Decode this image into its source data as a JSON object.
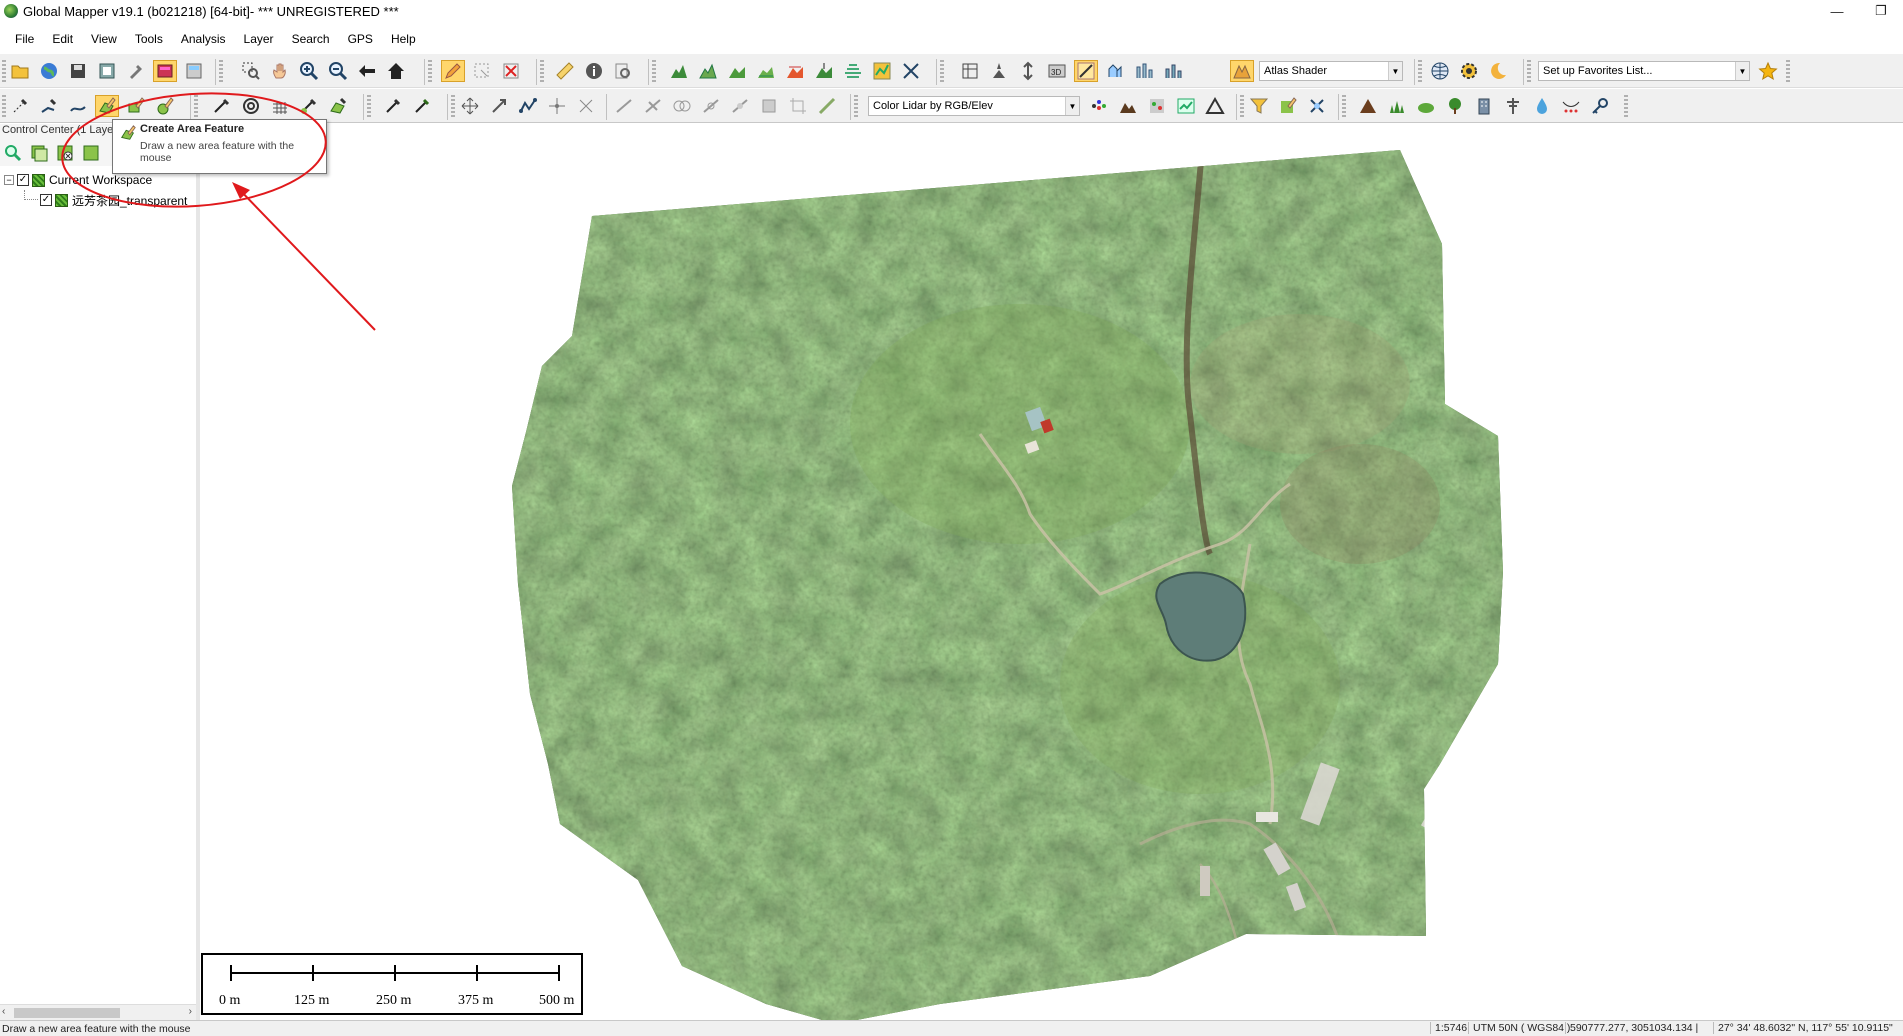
{
  "window": {
    "title": "Global Mapper v19.1 (b021218) [64-bit]- *** UNREGISTERED ***",
    "minimize": "—",
    "restore": "❐",
    "close": "✕"
  },
  "menu": [
    "File",
    "Edit",
    "View",
    "Tools",
    "Analysis",
    "Layer",
    "Search",
    "GPS",
    "Help"
  ],
  "toolbar": {
    "shader_combo": "Atlas Shader",
    "favorites_combo": "Set up Favorites List...",
    "lidar_combo": "Color Lidar by RGB/Elev"
  },
  "control_center": {
    "header": "Control Center (1 Laye",
    "workspace_label": "Current Workspace",
    "layer_label": "远芳茶园_transparent"
  },
  "tooltip": {
    "title": "Create Area Feature",
    "description": "Draw a new area feature with the mouse"
  },
  "scale_bar": {
    "labels": [
      "0 m",
      "125 m",
      "250 m",
      "375 m",
      "500 m"
    ]
  },
  "status": {
    "message": "Draw a new area feature with the mouse",
    "scale": "1:5746",
    "projection": "UTM 50N ( WGS84 )",
    "coords": "590777.277, 3051034.134 |",
    "latlon": "27° 34' 48.6032\" N, 117° 55' 10.9115\""
  },
  "colors": {
    "annotation": "#e0191c",
    "active_tool": "#ffd66b"
  }
}
